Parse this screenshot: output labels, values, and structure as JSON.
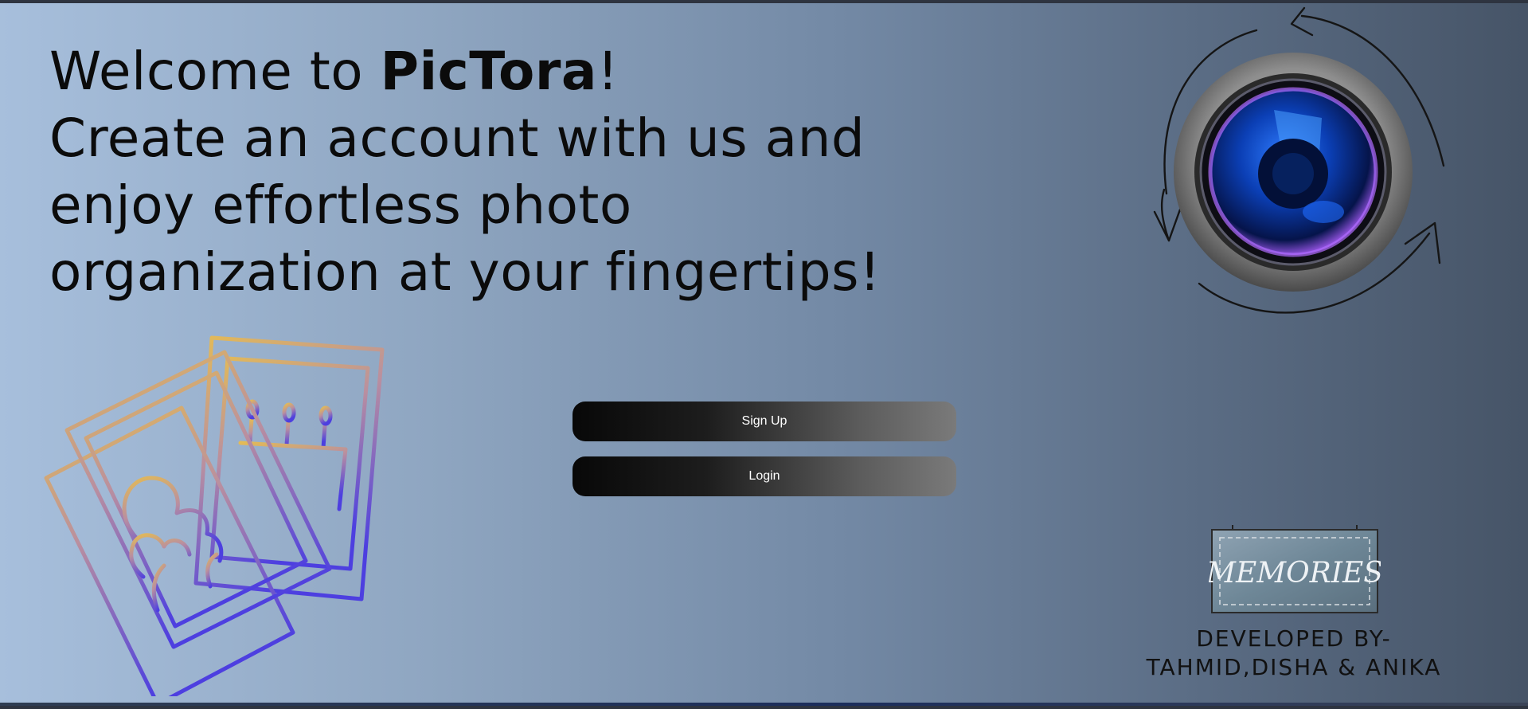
{
  "headline": {
    "welcome_prefix": "Welcome to ",
    "brand": "PicTora",
    "welcome_suffix": "!",
    "tagline": "Create an account with us and enjoy effortless photo organization at your fingertips!"
  },
  "actions": {
    "signup_label": "Sign Up",
    "login_label": "Login"
  },
  "decor": {
    "memories_sign_text": "MEMORIES",
    "photos_icon": "photos-stack-icon",
    "camera_icon": "camera-lens-icon"
  },
  "credits": {
    "line1": "DEVELOPED BY-",
    "line2": "TAHMID,DISHA & ANIKA"
  },
  "colors": {
    "background_start": "#a7bfdc",
    "background_end": "#465467",
    "button_dark": "#080808",
    "button_light": "#7a7a7a",
    "icon_gold": "#d9b05a",
    "icon_violet": "#5a46d8"
  }
}
